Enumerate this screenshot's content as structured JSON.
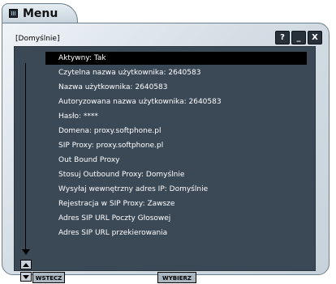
{
  "window": {
    "title": "Menu",
    "profile": "[Domyślnie]",
    "controls": {
      "help": "?",
      "minimize": "_",
      "close": "X"
    }
  },
  "menu": {
    "items": [
      {
        "label": "Aktywny: Tak",
        "selected": true
      },
      {
        "label": "Czytelna nazwa użytkownika: 2640583"
      },
      {
        "label": "Nazwa użytkownika: 2640583"
      },
      {
        "label": "Autoryzowana nazwa użytkownika: 2640583"
      },
      {
        "label": "Hasło: ****"
      },
      {
        "label": "Domena: proxy.softphone.pl"
      },
      {
        "label": "SIP Proxy: proxy.softphone.pl"
      },
      {
        "label": "Out Bound Proxy"
      },
      {
        "label": "Stosuj Outbound Proxy: Domyślnie"
      },
      {
        "label": "Wysyłaj wewnętrzny adres IP: Domyślnie"
      },
      {
        "label": "Rejestracja w SIP Proxy: Zawsze"
      },
      {
        "label": "Adres SIP URL Poczty Głosowej"
      },
      {
        "label": "Adres SIP URL przekierowania"
      }
    ]
  },
  "softkeys": {
    "back": "WSTECZ",
    "select": "WYBIERZ"
  },
  "colors": {
    "panel": "#3b4856",
    "selection": "#000000",
    "frame": "#d4dde4"
  }
}
